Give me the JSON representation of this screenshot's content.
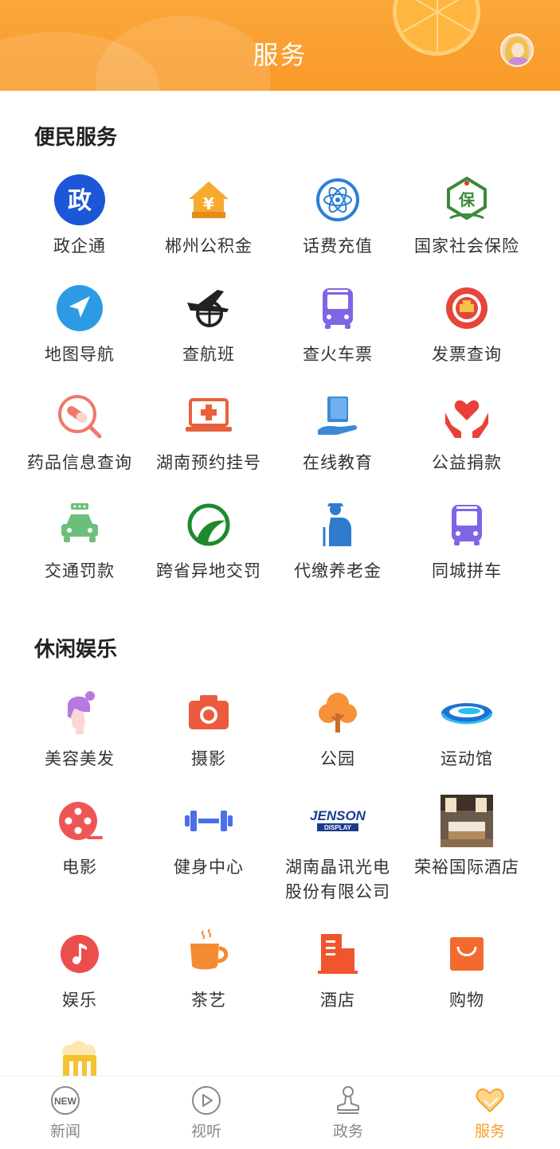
{
  "header": {
    "title": "服务"
  },
  "colors": {
    "accent": "#f99a28",
    "tab_active": "#f7a02b",
    "text": "#333333"
  },
  "sections": [
    {
      "title": "便民服务",
      "items": [
        {
          "label": "政企通",
          "icon": "gov-icon",
          "icon_text": "政"
        },
        {
          "label": "郴州公积金",
          "icon": "housing-fund-icon",
          "icon_text": "¥"
        },
        {
          "label": "话费充值",
          "icon": "atom-icon"
        },
        {
          "label": "国家社会保险",
          "icon": "insurance-icon",
          "icon_text": "保"
        },
        {
          "label": "地图导航",
          "icon": "navigation-icon"
        },
        {
          "label": "查航班",
          "icon": "airplane-globe-icon"
        },
        {
          "label": "查火车票",
          "icon": "bus-icon"
        },
        {
          "label": "发票查询",
          "icon": "national-emblem-icon"
        },
        {
          "label": "药品信息查询",
          "icon": "pill-search-icon"
        },
        {
          "label": "湖南预约挂号",
          "icon": "medical-laptop-icon"
        },
        {
          "label": "在线教育",
          "icon": "book-hand-icon"
        },
        {
          "label": "公益捐款",
          "icon": "heart-hands-icon"
        },
        {
          "label": "交通罚款",
          "icon": "car-icon"
        },
        {
          "label": "跨省异地交罚",
          "icon": "road-circle-icon"
        },
        {
          "label": "代缴养老金",
          "icon": "elderly-icon"
        },
        {
          "label": "同城拼车",
          "icon": "bus-icon"
        }
      ]
    },
    {
      "title": "休闲娱乐",
      "items": [
        {
          "label": "美容美发",
          "icon": "beauty-icon"
        },
        {
          "label": "摄影",
          "icon": "camera-icon"
        },
        {
          "label": "公园",
          "icon": "tree-icon"
        },
        {
          "label": "运动馆",
          "icon": "stadium-icon"
        },
        {
          "label": "电影",
          "icon": "film-reel-icon"
        },
        {
          "label": "健身中心",
          "icon": "dumbbell-icon"
        },
        {
          "label": "湖南晶讯光电\n股份有限公司",
          "icon": "jenson-logo-icon",
          "icon_text": "JENSON",
          "icon_subtext": "DISPLAY"
        },
        {
          "label": "荣裕国际酒店",
          "icon": "hotel-room-photo-icon"
        },
        {
          "label": "娱乐",
          "icon": "music-note-icon"
        },
        {
          "label": "茶艺",
          "icon": "tea-cup-icon"
        },
        {
          "label": "酒店",
          "icon": "building-icon"
        },
        {
          "label": "购物",
          "icon": "shopping-bag-icon"
        },
        {
          "label": "",
          "icon": "beer-icon"
        }
      ]
    }
  ],
  "tabbar": [
    {
      "label": "新闻",
      "icon": "new-badge-icon",
      "icon_text": "NEW",
      "active": false
    },
    {
      "label": "视听",
      "icon": "play-icon",
      "active": false
    },
    {
      "label": "政务",
      "icon": "stamp-icon",
      "active": false
    },
    {
      "label": "服务",
      "icon": "heart-tag-icon",
      "active": true
    }
  ]
}
